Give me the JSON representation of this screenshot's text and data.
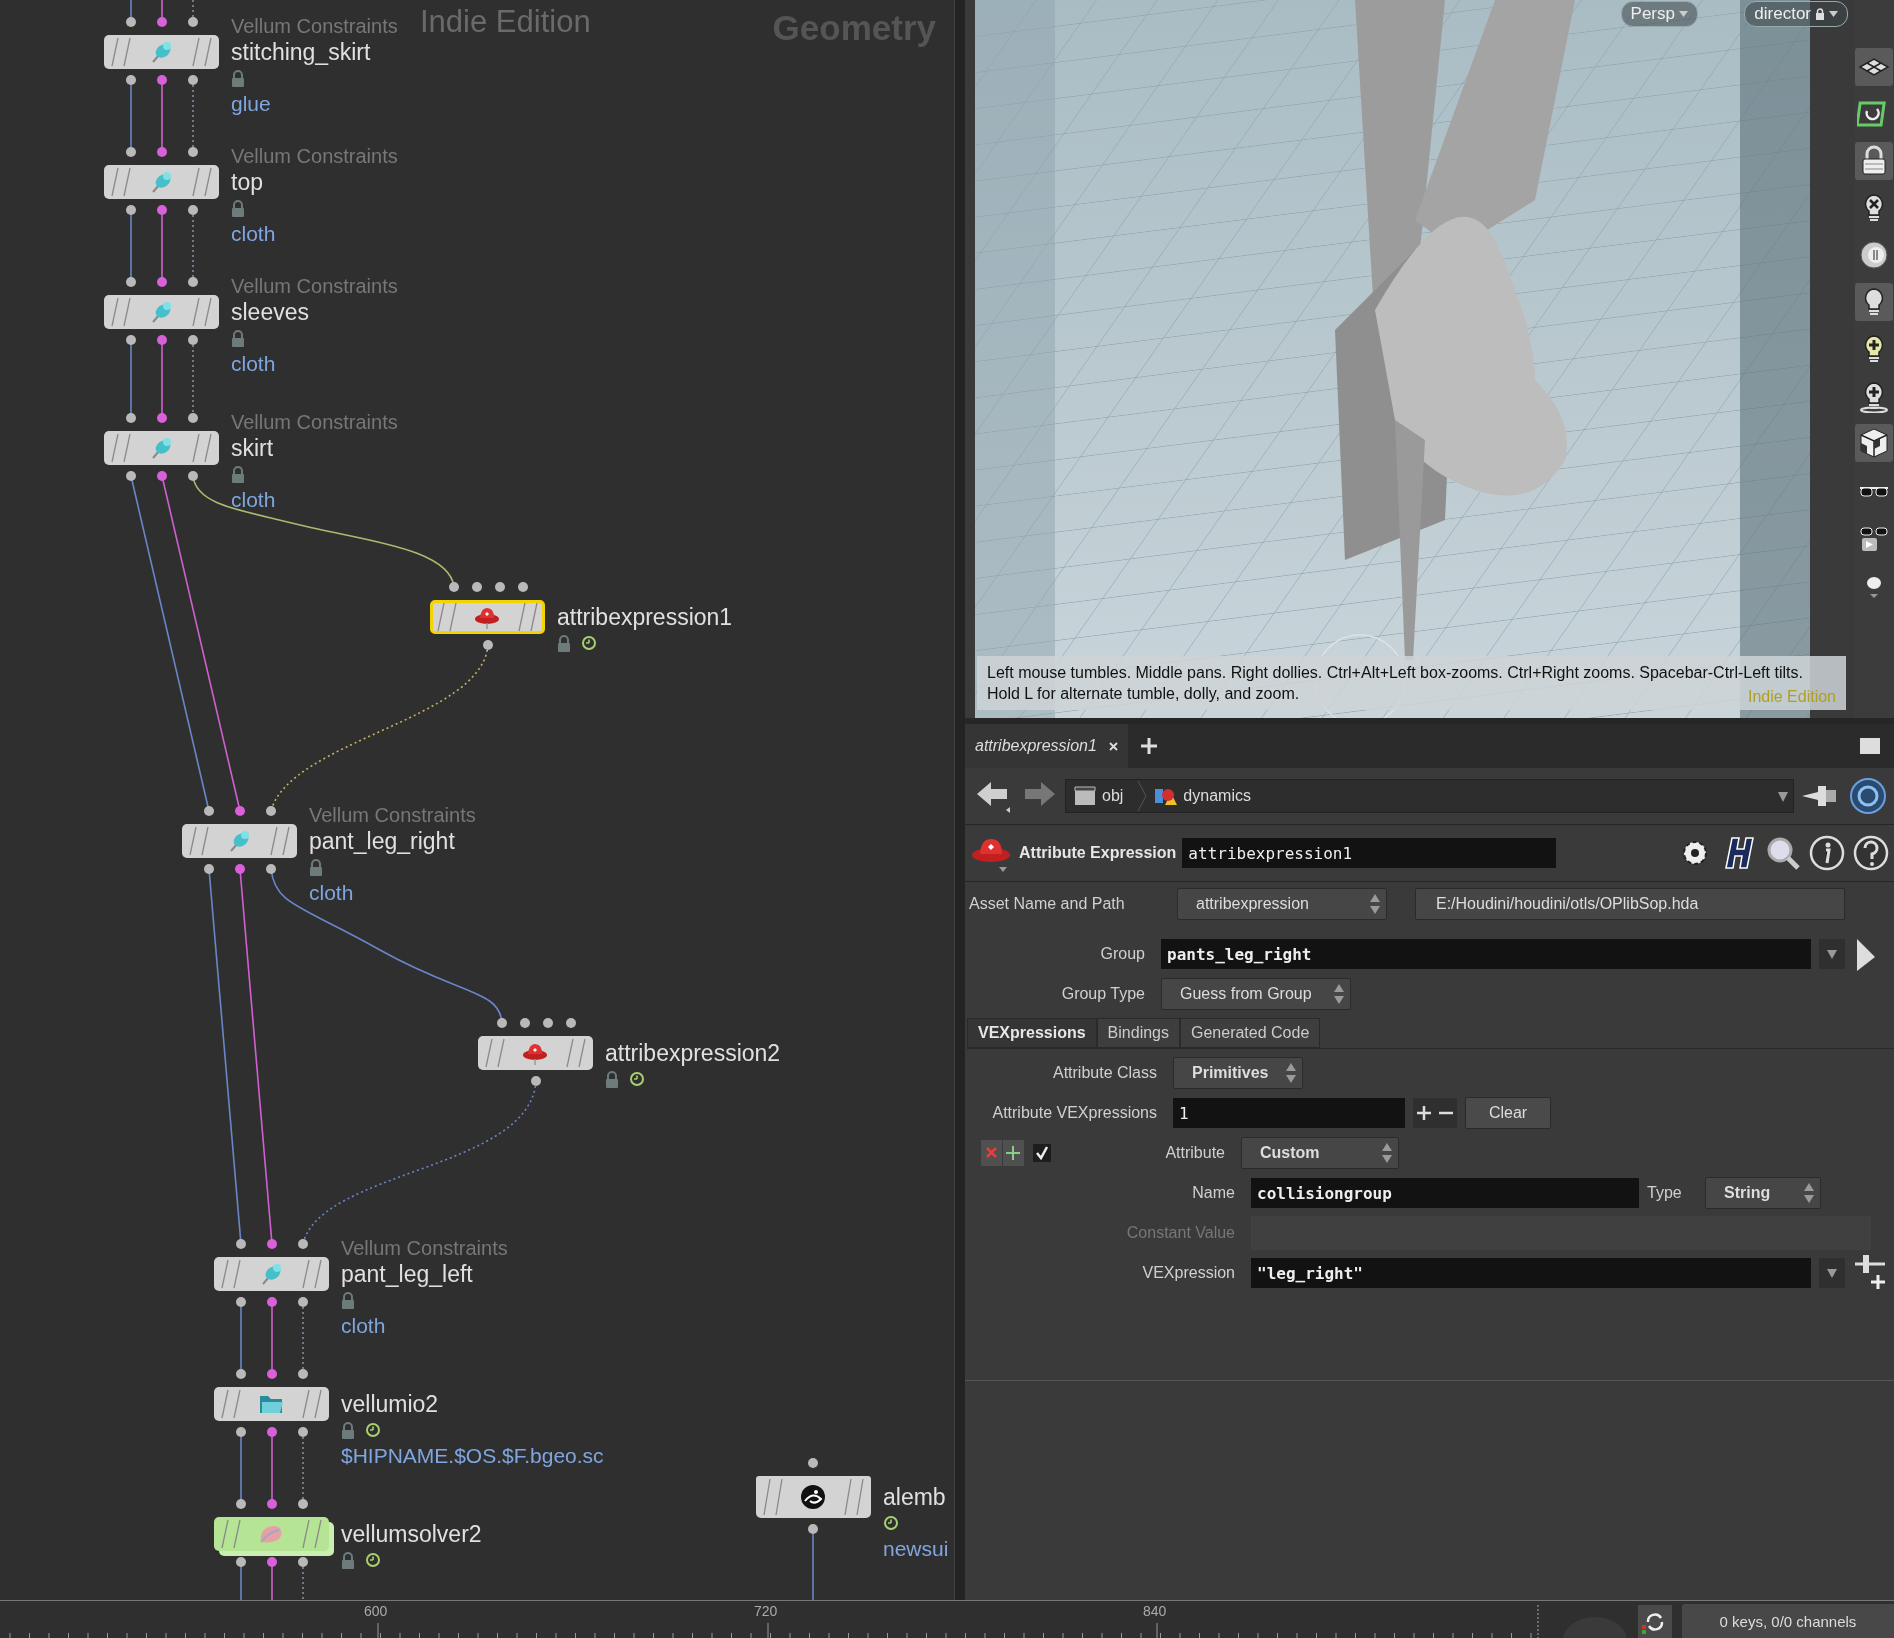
{
  "network": {
    "context": "Geometry",
    "edition": "Indie Edition",
    "nodes": [
      {
        "kind": "constraint",
        "type_label": "Vellum Constraints",
        "name": "stitching_skirt",
        "comment": "glue",
        "locked": true,
        "time_dependent": false,
        "selected": false,
        "display": false
      },
      {
        "kind": "constraint",
        "type_label": "Vellum Constraints",
        "name": "top",
        "comment": "cloth",
        "locked": true,
        "time_dependent": false,
        "selected": false,
        "display": false
      },
      {
        "kind": "constraint",
        "type_label": "Vellum Constraints",
        "name": "sleeves",
        "comment": "cloth",
        "locked": true,
        "time_dependent": false,
        "selected": false,
        "display": false
      },
      {
        "kind": "constraint",
        "type_label": "Vellum Constraints",
        "name": "skirt",
        "comment": "cloth",
        "locked": true,
        "time_dependent": false,
        "selected": false,
        "display": false
      },
      {
        "kind": "expression",
        "name": "attribexpression1",
        "locked": true,
        "time_dependent": true,
        "selected": true,
        "display": false
      },
      {
        "kind": "constraint",
        "type_label": "Vellum Constraints",
        "name": "pant_leg_right",
        "comment": "cloth",
        "locked": true,
        "time_dependent": false,
        "selected": false,
        "display": false
      },
      {
        "kind": "expression",
        "name": "attribexpression2",
        "locked": true,
        "time_dependent": true,
        "selected": false,
        "display": false
      },
      {
        "kind": "constraint",
        "type_label": "Vellum Constraints",
        "name": "pant_leg_left",
        "comment": "cloth",
        "locked": true,
        "time_dependent": false,
        "selected": false,
        "display": false
      },
      {
        "kind": "io",
        "name": "vellumio2",
        "comment": "$HIPNAME.$OS.$F.bgeo.sc",
        "locked": true,
        "time_dependent": true,
        "selected": false,
        "display": false
      },
      {
        "kind": "solver",
        "name": "vellumsolver2",
        "locked": true,
        "time_dependent": true,
        "selected": false,
        "display": true
      },
      {
        "kind": "alembic",
        "name": "alemb",
        "comment": "newsui",
        "locked": false,
        "time_dependent": true,
        "selected": false,
        "display": false
      }
    ]
  },
  "viewport": {
    "camera": "Persp",
    "view": "director",
    "hint_lines": [
      "Left mouse tumbles. Middle pans. Right dollies. Ctrl+Alt+Left box-zooms. Ctrl+Right zooms. Spacebar-Ctrl-Left tilts.",
      "Hold L for alternate tumble, dolly, and zoom."
    ],
    "edition": "Indie Edition",
    "tools": [
      {
        "kind": "grid",
        "on": true
      },
      {
        "kind": "snap",
        "on": false
      },
      {
        "kind": "lock",
        "on": true
      },
      {
        "kind": "no-light",
        "on": false
      },
      {
        "kind": "headlight",
        "on": false
      },
      {
        "kind": "light",
        "on": true
      },
      {
        "kind": "add-light",
        "on": false
      },
      {
        "kind": "add-light-ground",
        "on": false
      },
      {
        "kind": "shading",
        "on": true
      },
      {
        "kind": "stereo",
        "on": false
      },
      {
        "kind": "stereo-play",
        "on": false
      },
      {
        "kind": "ball",
        "on": false
      }
    ]
  },
  "parameters": {
    "tab": "attribexpression1",
    "path": [
      "obj",
      "dynamics"
    ],
    "node_type": "Attribute Expression",
    "node_name": "attribexpression1",
    "asset": {
      "label": "Asset Name and Path",
      "name": "attribexpression",
      "path": "E:/Houdini/houdini/otls/OPlibSop.hda"
    },
    "group": {
      "label": "Group",
      "value": "pants_leg_right"
    },
    "group_type": {
      "label": "Group Type",
      "value": "Guess from Group"
    },
    "tabs": [
      {
        "label": "VEXpressions",
        "selected": true
      },
      {
        "label": "Bindings",
        "selected": false
      },
      {
        "label": "Generated Code",
        "selected": false
      }
    ],
    "attribute_class": {
      "label": "Attribute Class",
      "value": "Primitives"
    },
    "count": {
      "label": "Attribute VEXpressions",
      "value": "1",
      "clear": "Clear"
    },
    "entry": {
      "enabled": true,
      "attribute": {
        "label": "Attribute",
        "value": "Custom"
      },
      "name": {
        "label": "Name",
        "value": "collisiongroup"
      },
      "type": {
        "label": "Type",
        "value": "String"
      },
      "constant": {
        "label": "Constant Value",
        "disabled": true
      },
      "vexpression": {
        "label": "VEXpression",
        "value": "\"leg_right\""
      }
    }
  },
  "timeline": {
    "ticks": [
      "600",
      "720",
      "840"
    ],
    "keys": "0 keys, 0/0 channels"
  }
}
